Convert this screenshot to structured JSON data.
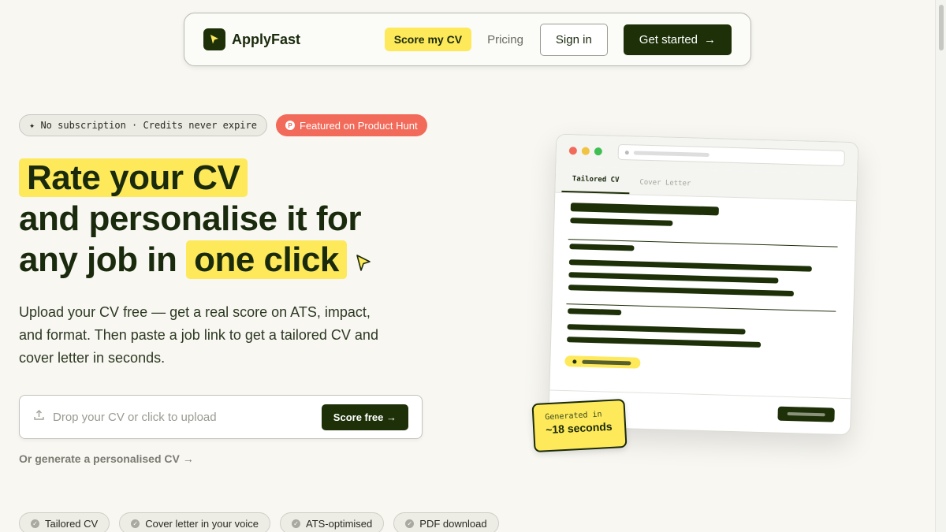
{
  "nav": {
    "brand": "ApplyFast",
    "score_label": "Score my CV",
    "pricing_label": "Pricing",
    "signin_label": "Sign in",
    "cta_label": "Get started",
    "cta_arrow": "→"
  },
  "badges": {
    "subscription": "✦ No subscription · Credits never expire",
    "product_hunt": "Featured on Product Hunt",
    "product_hunt_icon": "P"
  },
  "hero": {
    "line1_highlight": "Rate your CV",
    "line2": "and personalise it for",
    "line3_prefix": "any job in",
    "line3_highlight": "one click",
    "subtext": "Upload your CV free — get a real score on ATS, impact, and format. Then paste a job link to get a tailored CV and cover letter in seconds."
  },
  "upload": {
    "placeholder": "Drop your CV or click to upload",
    "button": "Score free →"
  },
  "generate_link": "Or generate a personalised CV →",
  "chips": [
    "Tailored CV",
    "Cover letter in your voice",
    "ATS-optimised",
    "PDF download"
  ],
  "mockup": {
    "tab_active": "Tailored CV",
    "tab_inactive": "Cover Letter",
    "badge_small": "Generated in",
    "badge_big": "~18 seconds"
  },
  "colors": {
    "accent_yellow": "#fde95a",
    "brand_dark": "#1d3008",
    "product_hunt_red": "#f26a59",
    "background": "#f8f7f2"
  },
  "icons": {
    "logo": "cursor-arrow-icon",
    "upload": "upload-icon",
    "cursor": "cursor-arrow-icon",
    "chip": "check-circle-icon"
  }
}
